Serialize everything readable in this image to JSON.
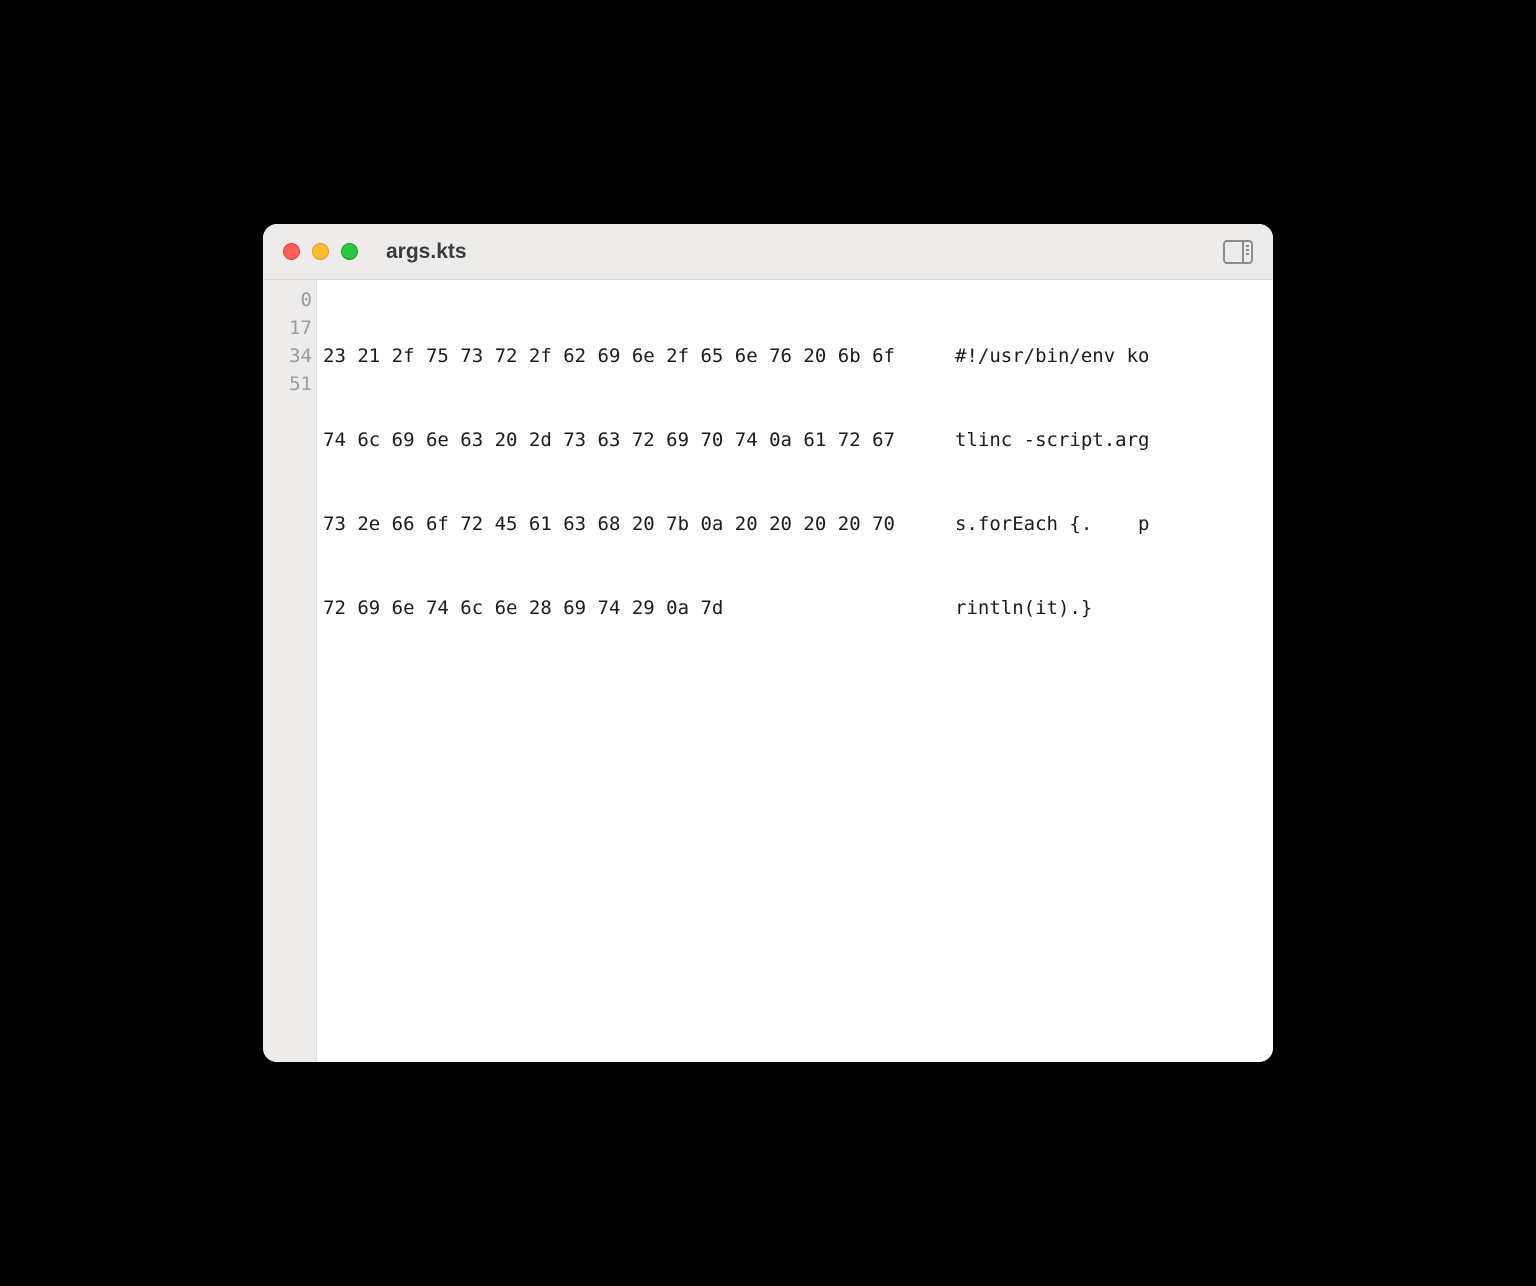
{
  "window": {
    "title": "args.kts"
  },
  "hexdump": {
    "rows": [
      {
        "offset": "0",
        "hex": "23 21 2f 75 73 72 2f 62 69 6e 2f 65 6e 76 20 6b 6f",
        "ascii": "#!/usr/bin/env ko"
      },
      {
        "offset": "17",
        "hex": "74 6c 69 6e 63 20 2d 73 63 72 69 70 74 0a 61 72 67",
        "ascii": "tlinc -script.arg"
      },
      {
        "offset": "34",
        "hex": "73 2e 66 6f 72 45 61 63 68 20 7b 0a 20 20 20 20 70",
        "ascii": "s.forEach {.    p"
      },
      {
        "offset": "51",
        "hex": "72 69 6e 74 6c 6e 28 69 74 29 0a 7d",
        "ascii": "rintln(it).}"
      }
    ]
  }
}
